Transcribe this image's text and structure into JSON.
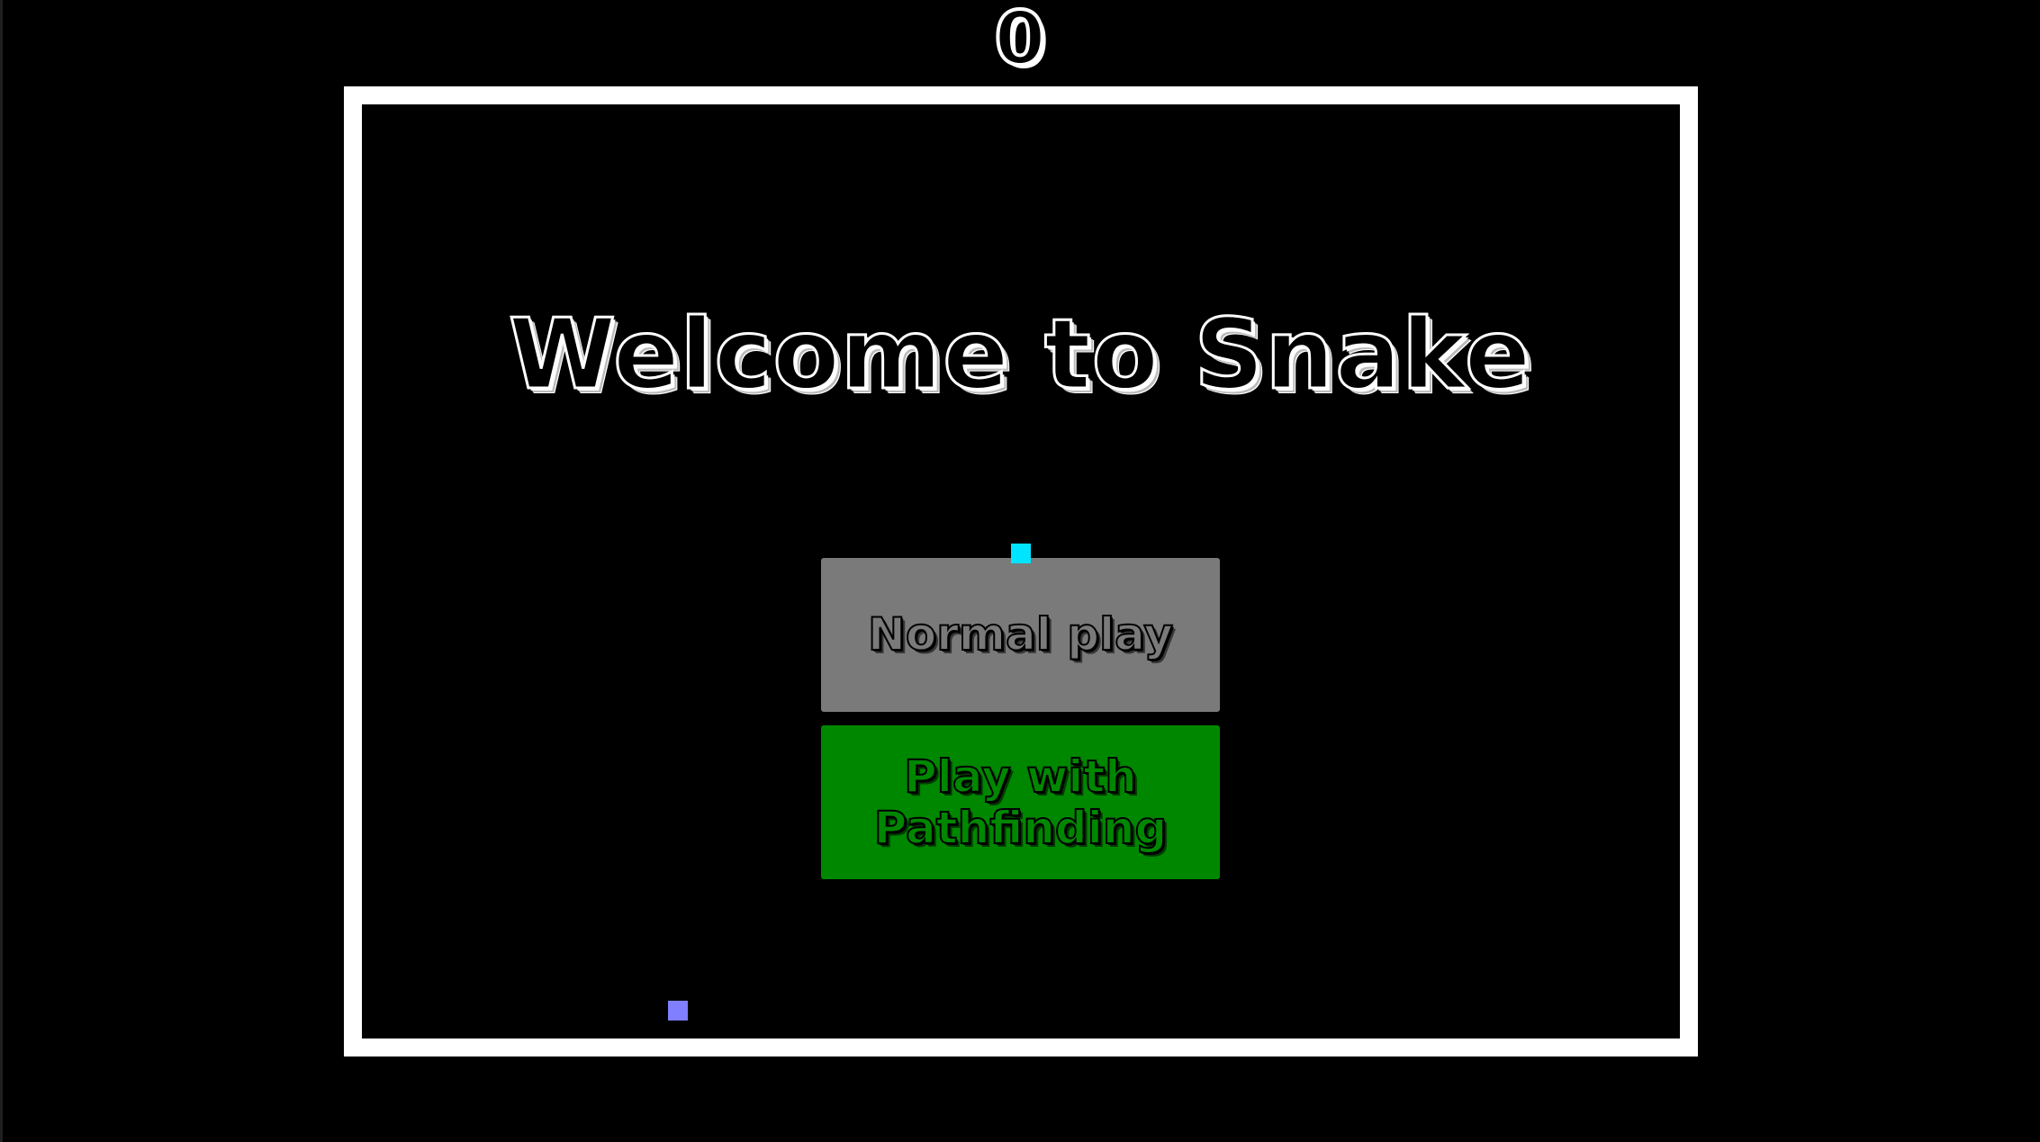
{
  "hud": {
    "score": "0"
  },
  "menu": {
    "title": "Welcome to Snake",
    "normal_play_label": "Normal play",
    "pathfinding_label": "Play with Pathfinding"
  },
  "game": {
    "snake_head_color": "#00e5ff",
    "food_color": "#7f7fff"
  },
  "colors": {
    "background": "#000000",
    "board_border": "#ffffff",
    "normal_button": "#7a7a7a",
    "pathfinding_button": "#008700"
  }
}
